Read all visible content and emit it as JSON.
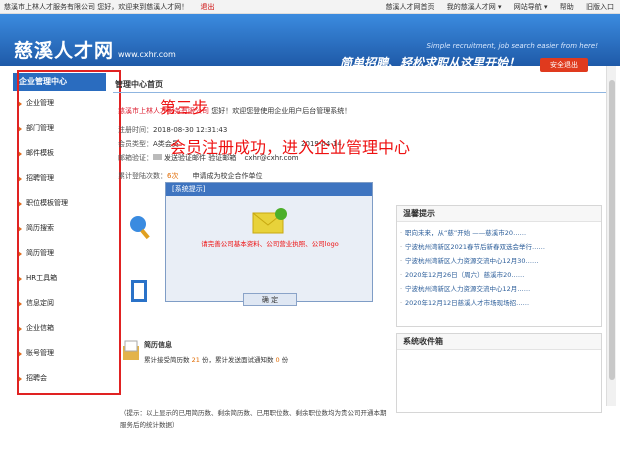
{
  "topbar": {
    "company": "慈溪市上林人才服务有限公司",
    "greeting": "您好，欢迎来到慈溪人才网！",
    "logout": "退出",
    "links": [
      "慈溪人才网首页",
      "我的慈溪人才网 ▾",
      "网站导航 ▾",
      "帮助",
      "旧版入口"
    ]
  },
  "header": {
    "logo": "慈溪人才网",
    "url": "www.cxhr.com",
    "slogan_en": "Simple recruitment, job search easier from here!",
    "slogan": "简单招聘、轻松求职从这里开始！",
    "exit": "安全退出"
  },
  "sidebar": {
    "title": "企业管理中心",
    "items": [
      "企业管理",
      "部门管理",
      "邮件模板",
      "招聘管理",
      "职位模板管理",
      "简历搜索",
      "简历管理",
      "HR工具箱",
      "信息定阅",
      "企业信箱",
      "账号管理",
      "招聘会"
    ]
  },
  "main": {
    "title": "管理中心首页",
    "welcome_company": "慈溪市上林人才服务有限公司",
    "welcome": "您好！欢迎您登使用企业用户后台管理系统！",
    "reg_time_label": "注册时间：",
    "reg_time": "2018-08-30 12:31:43",
    "member_label": "会员类型：",
    "member": "A类会员",
    "member_extra": "2019-04-14",
    "email_label": "邮箱验证：",
    "email_status": "发送验证邮件 验证邮箱",
    "email": "cxhr@cxhr.com",
    "login_label": "累计登陆次数：",
    "login_count": "6次",
    "login_tail": "申请成为校企合作单位"
  },
  "annot": {
    "step": "第三步",
    "note": "会员注册成功，进入企业管理中心"
  },
  "news": {
    "title": "温馨提示",
    "items": [
      "职向未来，从“慈”开始 ——慈溪市20……",
      "宁波杭州湾新区2021春节后新春双选会举行……",
      "宁波杭州湾新区人力资源交流中心12月30……",
      "2020年12月26日（周六）慈溪市20……",
      "宁波杭州湾新区人力资源交流中心12月……",
      "2020年12月12日慈溪人才市场现场招……"
    ]
  },
  "mailbox": {
    "title": "系统收件箱"
  },
  "resume": {
    "title": "简历信息",
    "p1": "累计接受简历数",
    "n1": "21",
    "p2": "份，累计发送面试通知数",
    "n2": "0",
    "p3": "份"
  },
  "tip": "（提示：以上显示的已用简历数、剩余简历数、已用职位数、剩余职位数均为贵公司开通本期服务后的统计数据）",
  "dialog": {
    "title": "[系统提示]",
    "message": "请完善公司基本资料、公司营业执照、公司logo",
    "ok": "确 定"
  },
  "colors": {
    "brand": "#2a6cbf",
    "accent": "#e03a1e",
    "annotation": "#e11111"
  }
}
